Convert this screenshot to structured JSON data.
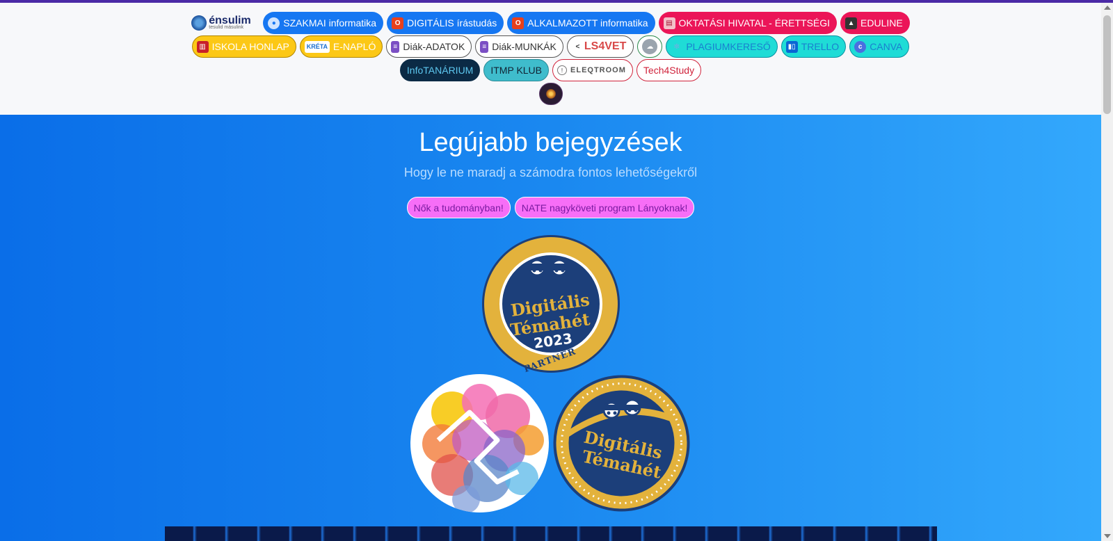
{
  "nav": {
    "row1": [
      {
        "label": "SZAKMAI informatika",
        "style": "blue",
        "icon": "person-icon"
      },
      {
        "label": "DIGITÁLIS írástudás",
        "style": "blue",
        "icon": "office-icon"
      },
      {
        "label": "ALKALMAZOTT informatika",
        "style": "blue",
        "icon": "office-icon"
      },
      {
        "label": "OKTATÁSI HIVATAL - ÉRETTSÉGI",
        "style": "red",
        "icon": "document-icon"
      },
      {
        "label": "EDULINE",
        "style": "red",
        "icon": "graduation-cap-icon"
      }
    ],
    "row2": [
      {
        "label": "ISKOLA HONLAP",
        "style": "yellow",
        "icon": "book-icon"
      },
      {
        "label": "E-NAPLÓ",
        "style": "yellow",
        "icon": "kreta-logo-icon"
      },
      {
        "label": "Diák-ADATOK",
        "style": "outline-dark",
        "icon": "google-forms-icon"
      },
      {
        "label": "Diák-MUNKÁK",
        "style": "outline-dark",
        "icon": "google-forms-icon"
      },
      {
        "label": "",
        "style": "outline-dark",
        "icon": "cloud-icon"
      },
      {
        "label": "PLAGIUMKERESŐ",
        "style": "cyan",
        "icon": "gear-icon"
      },
      {
        "label": "TRELLO",
        "style": "cyan",
        "icon": "trello-icon"
      },
      {
        "label": "CANVA",
        "style": "cyan",
        "icon": "canva-icon"
      }
    ],
    "row3": [
      {
        "label": "InfoTANÁRIUM",
        "style": "navy"
      },
      {
        "label": "ITMP KLUB",
        "style": "teal"
      },
      {
        "label": "Tech4Study",
        "style": "outline-red"
      }
    ],
    "logo_text": "énsulim",
    "logo_subtext": "tesulid másulink",
    "ls4vet_text": "LS4VET",
    "eleqtroom_text": "ELEQTROOM"
  },
  "hero": {
    "title": "Legújabb bejegyzések",
    "subtitle": "Hogy le ne maradj a számodra fontos lehetőségekről",
    "tags": [
      "Nők a tudományban!",
      "NATE nagyköveti program Lányoknak!"
    ]
  },
  "badges": {
    "partner": {
      "line1": "Digitális",
      "line2": "Témahét",
      "year": "2023",
      "ribbon": "PARTNER"
    },
    "plain": {
      "line1": "Digitális",
      "line2": "Témahét"
    }
  },
  "colors": {
    "accent_top": "#4b2aa6",
    "hero_start": "#0a6ee8",
    "hero_end": "#33a8fc",
    "badge_gold": "#e3b23c",
    "badge_navy": "#1c3f7a"
  }
}
